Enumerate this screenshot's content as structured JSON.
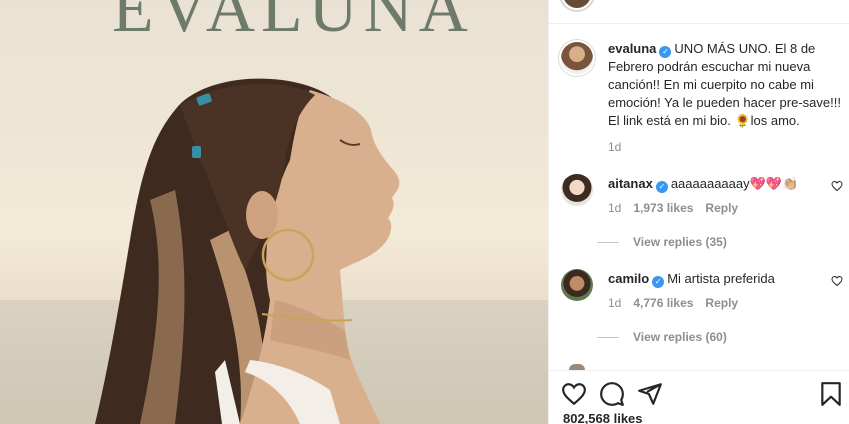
{
  "photo": {
    "headline": "EVALUNA"
  },
  "caption": {
    "username": "evaluna",
    "text": "UNO MÁS UNO. El 8 de Febrero podrán escuchar mi nueva canción!! En mi cuerpito no cabe mi emoción! Ya le pueden hacer pre-save!!! El link está en mi bio. 🌻los amo.",
    "time": "1d"
  },
  "comments": [
    {
      "username": "aitanax",
      "text": "aaaaaaaaaay💖💖👏🏼",
      "time": "1d",
      "likes": "1,973 likes",
      "reply": "Reply",
      "view_replies": "View replies (35)"
    },
    {
      "username": "camilo",
      "text": "Mi artista preferida",
      "time": "1d",
      "likes": "4,776 likes",
      "reply": "Reply",
      "view_replies": "View replies (60)"
    }
  ],
  "actions": {
    "likes_count": "802,568 likes",
    "icons": [
      "heart-icon",
      "comment-icon",
      "share-icon",
      "bookmark-icon"
    ]
  },
  "colors": {
    "verified": "#3897f0",
    "muted": "#8e8e8e",
    "text": "#262626"
  }
}
